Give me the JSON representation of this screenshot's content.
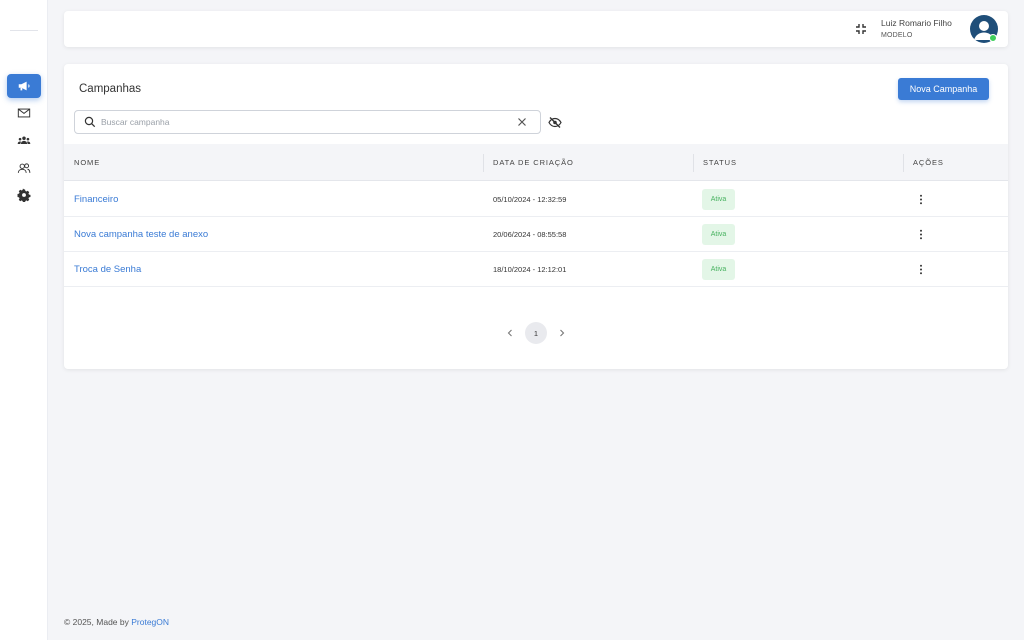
{
  "sidebar": {
    "items": [
      {
        "icon": "megaphone-icon",
        "active": true
      },
      {
        "icon": "mail-icon",
        "active": false
      },
      {
        "icon": "group-icon",
        "active": false
      },
      {
        "icon": "users-icon",
        "active": false
      },
      {
        "icon": "gear-icon",
        "active": false
      }
    ]
  },
  "header": {
    "user_name": "Luiz Romario Filho",
    "user_role": "MODELO",
    "online_color": "#3ecf5b"
  },
  "main": {
    "title": "Campanhas",
    "new_button": "Nova Campanha",
    "search": {
      "placeholder": "Buscar campanha",
      "value": ""
    },
    "table": {
      "columns": [
        "NOME",
        "DATA DE CRIAÇÃO",
        "STATUS",
        "AÇÕES"
      ],
      "rows": [
        {
          "name": "Financeiro",
          "created": "05/10/2024 - 12:32:59",
          "status": "Ativa"
        },
        {
          "name": "Nova campanha teste de anexo",
          "created": "20/06/2024 - 08:55:58",
          "status": "Ativa"
        },
        {
          "name": "Troca de Senha",
          "created": "18/10/2024 - 12:12:01",
          "status": "Ativa"
        }
      ]
    },
    "pagination": {
      "current_page": "1"
    }
  },
  "footer": {
    "text": "© 2025, Made by ",
    "link": "ProtegON"
  },
  "colors": {
    "accent": "#3a7bd5",
    "status_active_bg": "#e3f6e7",
    "status_active_text": "#47b25f"
  }
}
